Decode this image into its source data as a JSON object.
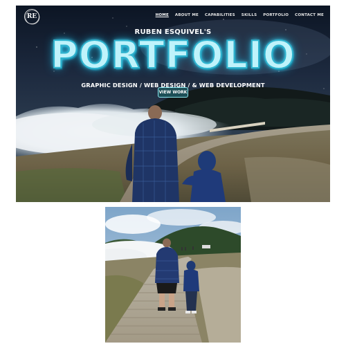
{
  "hero": {
    "logo_text": "RE",
    "nav": [
      {
        "label": "HOME",
        "active": true
      },
      {
        "label": "ABOUT ME",
        "active": false
      },
      {
        "label": "CAPABILITIES",
        "active": false
      },
      {
        "label": "SKILLS",
        "active": false
      },
      {
        "label": "PORTFOLIO",
        "active": false
      },
      {
        "label": "CONTACT ME",
        "active": false
      }
    ],
    "subtitle": "RUBEN ESQUIVEL'S",
    "title": "PORTFOLIO",
    "tagline": "GRAPHIC DESIGN / WEB DESIGN / & WEB DEVELOPMENT",
    "cta_label": "VIEW WORK",
    "colors": {
      "title_fill": "#bff3fb",
      "title_glow": "#2fb4cf",
      "button_bg": "#1d4f57",
      "button_border": "#8be7ef"
    }
  }
}
